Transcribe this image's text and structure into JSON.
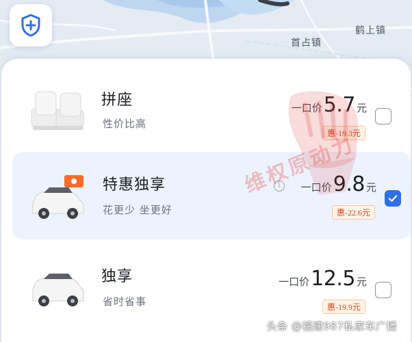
{
  "map": {
    "labels": [
      "首占镇",
      "鹤上镇"
    ]
  },
  "options": [
    {
      "name": "拼座",
      "subtitle": "性价比高",
      "price_prefix": "一口价",
      "price": "5.7",
      "price_unit": "元",
      "discount": "惠-19.3元",
      "selected": false,
      "thumb_icon": "seat-icon"
    },
    {
      "name": "特惠独享",
      "subtitle": "花更少 坐更好",
      "price_prefix": "一口价",
      "price": "9.8",
      "price_unit": "元",
      "discount": "惠-22.6元",
      "selected": true,
      "thumb_icon": "car-with-coupon-icon",
      "info_icon": "i"
    },
    {
      "name": "独享",
      "subtitle": "省时省事",
      "price_prefix": "一口价",
      "price": "12.5",
      "price_unit": "元",
      "discount": "惠-19.9元",
      "selected": false,
      "thumb_icon": "car-icon"
    }
  ],
  "watermark": "维权原动力",
  "attribution": "头条 @福建987私家车广播",
  "colors": {
    "accent": "#2f6fe6",
    "discount": "#d2431f",
    "selected_bg": "#edf3fc"
  }
}
